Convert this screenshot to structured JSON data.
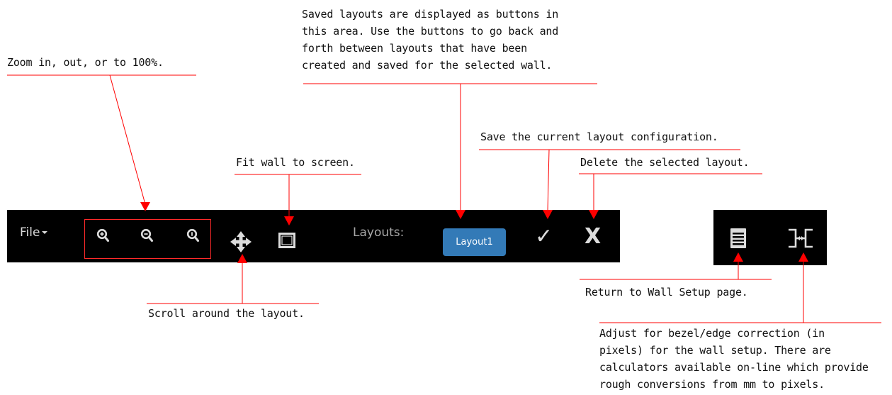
{
  "toolbar": {
    "file_label": "File",
    "layouts_label": "Layouts:",
    "layout_button_label": "Layout1",
    "icons": [
      "zoom-in-icon",
      "zoom-out-icon",
      "zoom-reset-icon",
      "move-arrows-icon",
      "fit-screen-icon",
      "checkmark-icon",
      "x-icon",
      "list-icon",
      "bezel-correction-icon"
    ]
  },
  "callouts": {
    "zoom": "Zoom in, out, or to 100%.",
    "saved_layouts": "Saved layouts are displayed as buttons in\nthis area. Use the buttons to go back and\nforth between layouts that have been\ncreated and saved for the selected wall.",
    "save": "Save the current layout configuration.",
    "fit": "Fit wall to screen.",
    "delete": "Delete the selected layout.",
    "scroll": "Scroll around the layout.",
    "wall_setup": "Return to Wall Setup page.",
    "bezel": "Adjust for bezel/edge correction (in\npixels) for the wall setup. There are\ncalculators available on-line which provide\nrough conversions from mm to pixels."
  },
  "colors": {
    "toolbar_bg": "#000000",
    "icon": "#dcdcdc",
    "layout_button": "#337ab7",
    "callout_line": "#ff0000"
  }
}
